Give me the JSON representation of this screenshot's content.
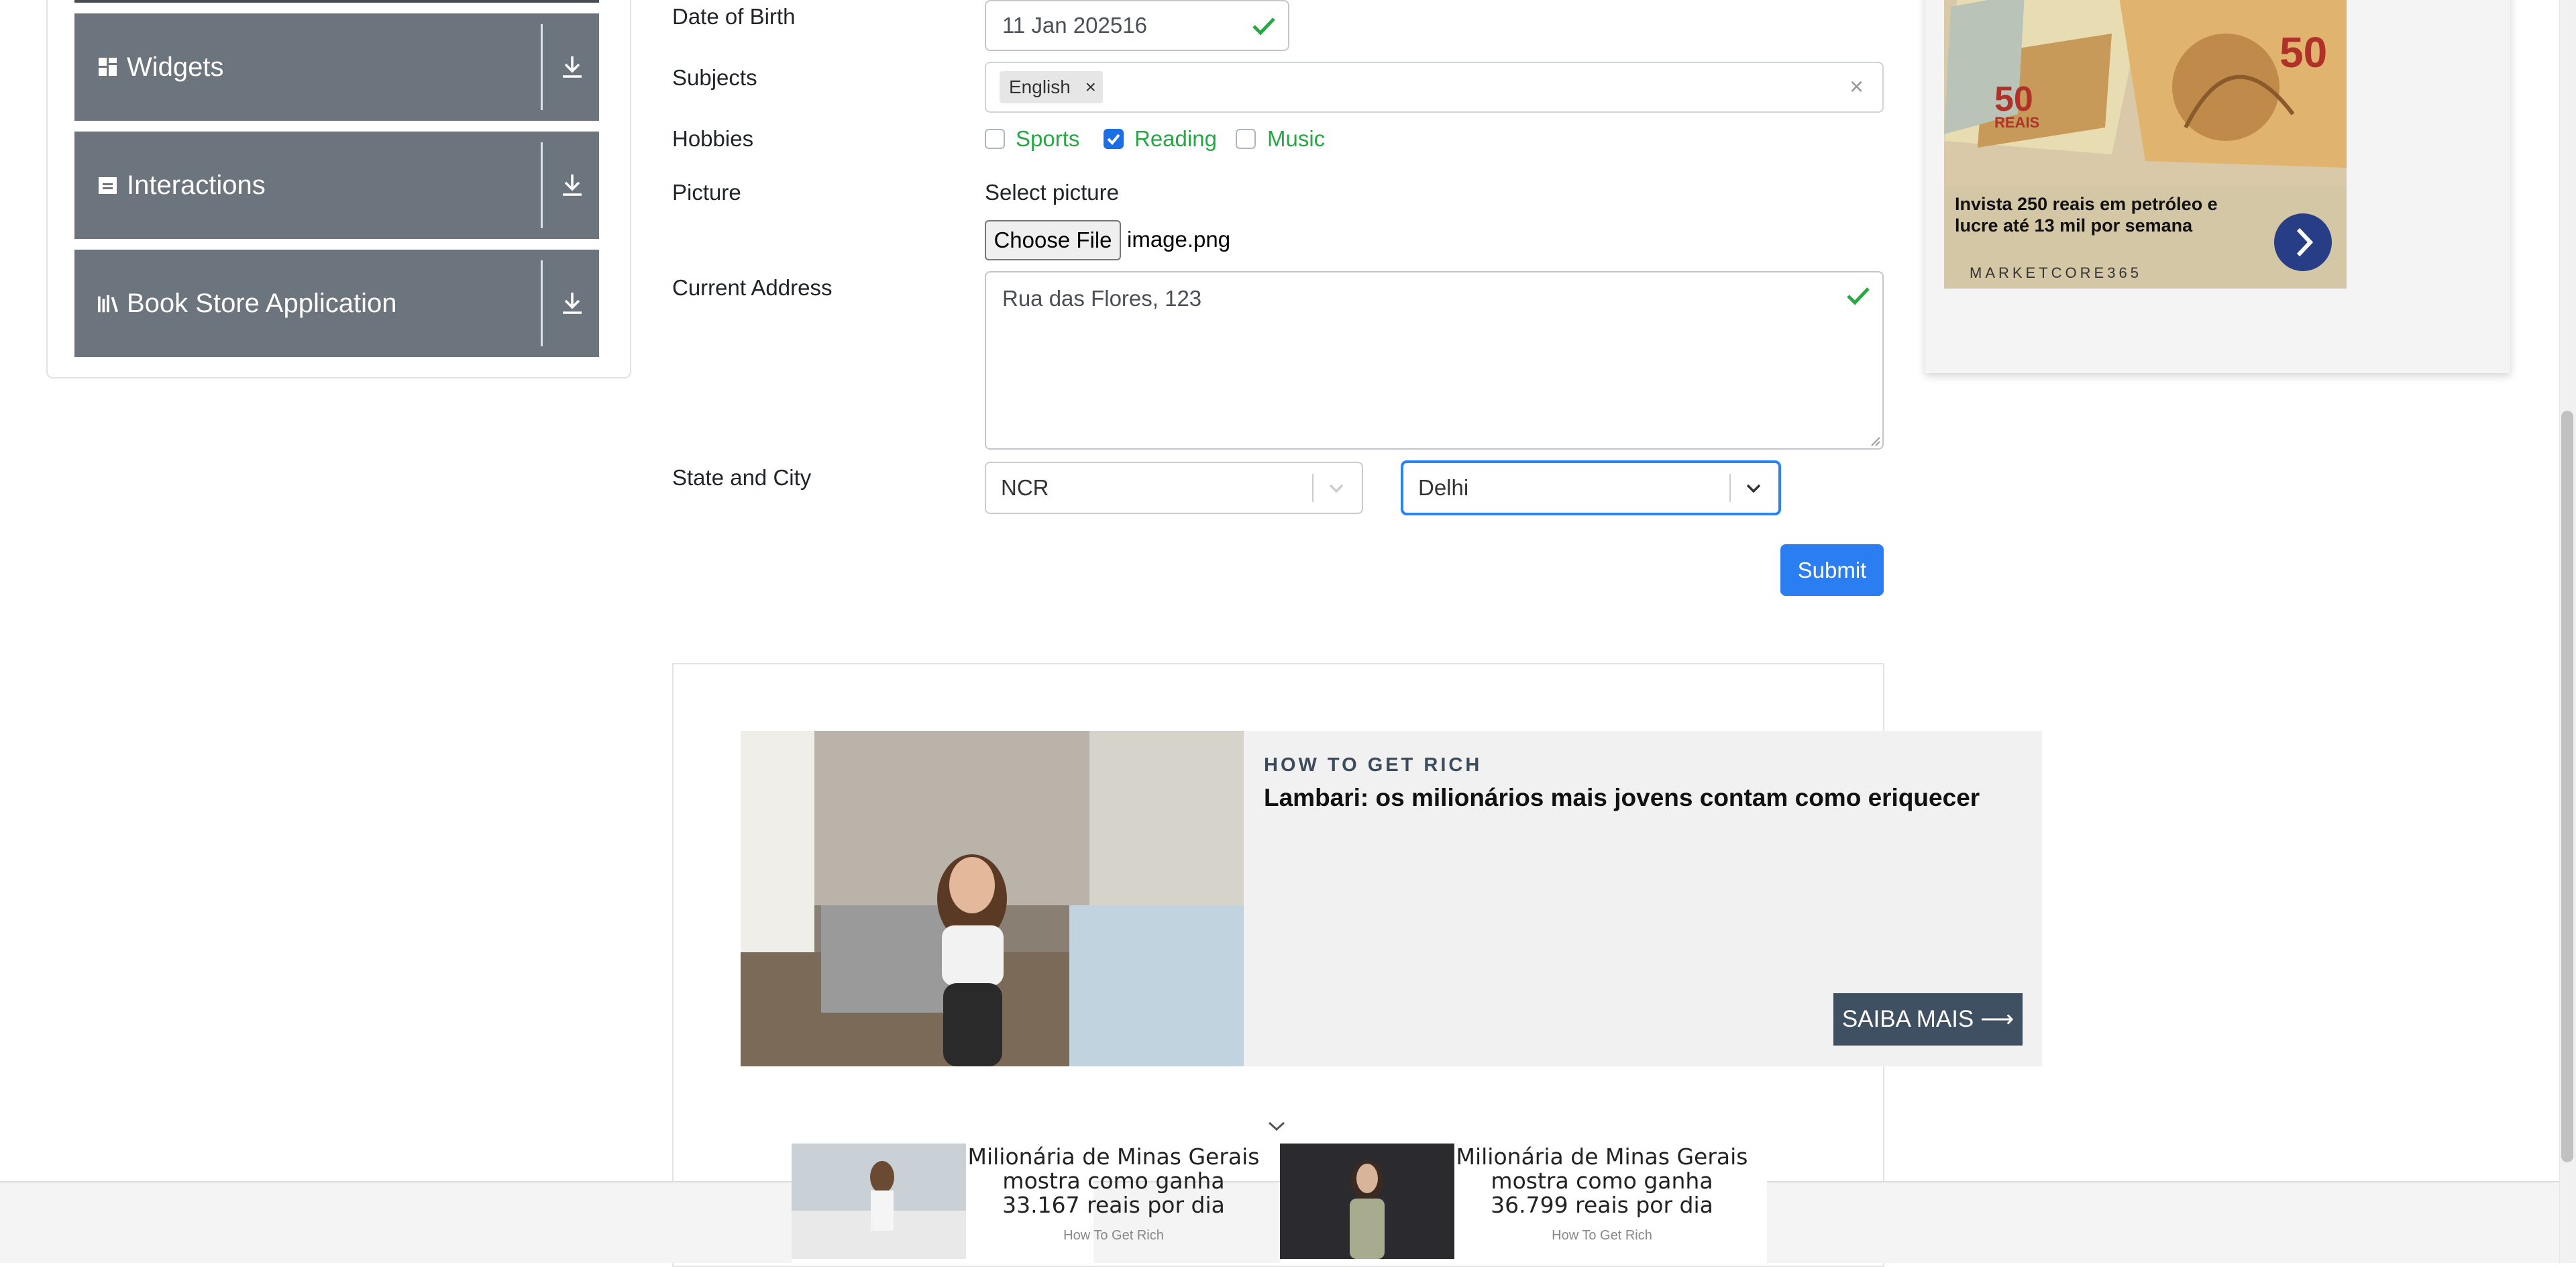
{
  "sidebar": {
    "groups": [
      {
        "label": "Widgets",
        "icon": "widgets-grid-icon"
      },
      {
        "label": "Interactions",
        "icon": "interactions-icon"
      },
      {
        "label": "Book Store Application",
        "icon": "book-store-icon"
      }
    ]
  },
  "form": {
    "dob": {
      "label": "Date of Birth",
      "value": "11 Jan 202516"
    },
    "subjects": {
      "label": "Subjects",
      "tags": [
        "English"
      ],
      "tag_remove": "×",
      "clear": "×"
    },
    "hobbies": {
      "label": "Hobbies",
      "options": [
        {
          "label": "Sports",
          "checked": false
        },
        {
          "label": "Reading",
          "checked": true
        },
        {
          "label": "Music",
          "checked": false
        }
      ]
    },
    "picture": {
      "label": "Picture",
      "prompt": "Select picture",
      "button": "Choose File",
      "file_name": "image.png"
    },
    "address": {
      "label": "Current Address",
      "value": "Rua das Flores, 123"
    },
    "state_city": {
      "label": "State and City",
      "state": "NCR",
      "city": "Delhi"
    },
    "submit": "Submit"
  },
  "ads": {
    "right": {
      "headline": "Invista 250 reais em petróleo e lucre até 13 mil por semana",
      "brand": "MARKETCORE365",
      "note_value": "50",
      "note_currency": "REAIS"
    },
    "main": {
      "kicker": "HOW TO GET RICH",
      "headline": "Lambari: os milionários mais jovens contam como eriquecer",
      "cta": "SAIBA MAIS ⟶"
    },
    "bottom": [
      {
        "text": "Milionária de Minas Gerais mostra como ganha 33.167 reais por dia",
        "source": "How To Get Rich"
      },
      {
        "text": "Milionária de Minas Gerais mostra como ganha 36.799 reais por dia",
        "source": "How To Get Rich"
      }
    ]
  },
  "colors": {
    "sidebar_group": "#6c757d",
    "primary": "#2a7ef2",
    "valid": "#28a745",
    "ad_cta": "#3f5063"
  }
}
